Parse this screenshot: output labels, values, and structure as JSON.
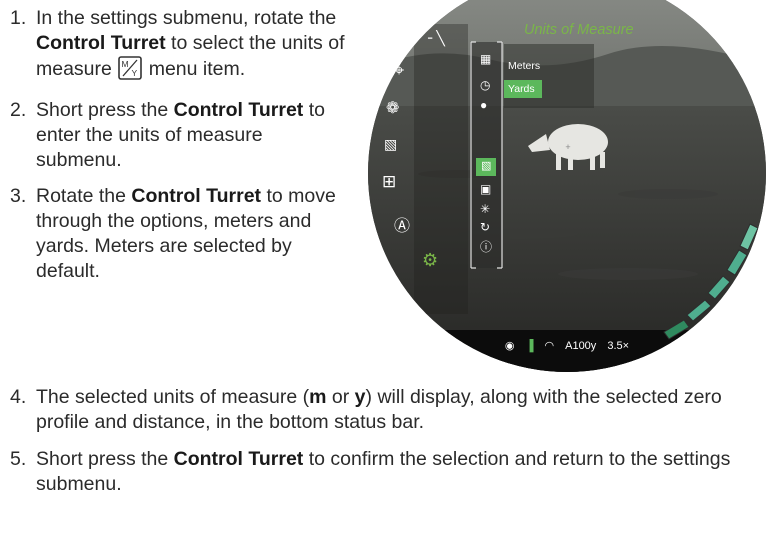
{
  "steps_top": [
    {
      "num": "1.",
      "pre": "In the settings submenu, rotate the ",
      "bold": "Control Turret",
      "mid": " to select the units of measure ",
      "icon": "units-of-measure-icon",
      "post": " menu item."
    },
    {
      "num": "2.",
      "pre": "Short press the ",
      "bold": "Control Turret",
      "post": " to enter the units of measure submenu."
    },
    {
      "num": "3.",
      "pre": "Rotate the ",
      "bold": "Control Turret",
      "post": " to move through the options, meters and yards. Meters are selected by default."
    }
  ],
  "steps_bottom": [
    {
      "num": "4.",
      "pre": "The selected units of measure (",
      "b1": "m",
      "or": " or ",
      "b2": "y",
      "post": ") will display, along with the selected zero profile and distance, in the bottom status bar."
    },
    {
      "num": "5.",
      "pre": "Short press the ",
      "bold": "Control Turret",
      "post": " to confirm the selection and return to the settings submenu."
    }
  ],
  "scope": {
    "menu_title": "Units of Measure",
    "options": [
      "Meters",
      "Yards"
    ],
    "selected_option": "Yards",
    "accent_color": "#5cb85c",
    "title_color": "#7ab648",
    "status_bar": {
      "range": "A100y",
      "zoom": "3.5×",
      "icons": [
        "eye-icon",
        "battery-icon",
        "wifi-icon"
      ]
    },
    "left_icons": [
      "rifle-icon",
      "crosshair-icon",
      "aperture-icon",
      "screen-icon",
      "plus-box-icon",
      "compass-icon",
      "gear-icon"
    ],
    "submenu_icons": [
      "calendar-icon",
      "clock-icon",
      "globe-icon",
      "units-of-measure-icon",
      "display-icon",
      "brightness-icon",
      "reset-icon",
      "info-icon"
    ],
    "selected_submenu_icon": "units-of-measure-icon"
  }
}
